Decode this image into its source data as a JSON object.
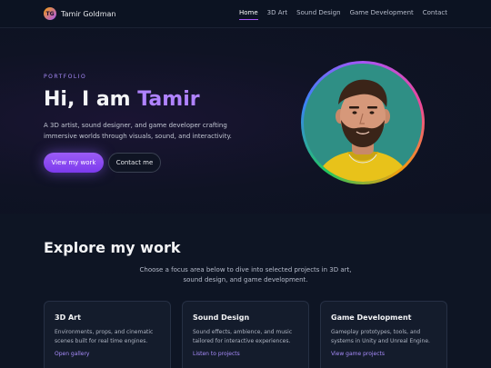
{
  "brand": {
    "initials": "TG",
    "name": "Tamir Goldman"
  },
  "nav": {
    "items": [
      {
        "label": "Home",
        "active": true
      },
      {
        "label": "3D Art",
        "active": false
      },
      {
        "label": "Sound Design",
        "active": false
      },
      {
        "label": "Game Development",
        "active": false
      },
      {
        "label": "Contact",
        "active": false
      }
    ]
  },
  "hero": {
    "kicker": "PORTFOLIO",
    "title_prefix": "Hi, I am ",
    "title_name": "Tamir",
    "description": "A 3D artist, sound designer, and game developer crafting immersive worlds through visuals, sound, and interactivity.",
    "primary_cta": "View my work",
    "secondary_cta": "Contact me"
  },
  "explore": {
    "title": "Explore my work",
    "description": "Choose a focus area below to dive into selected projects in 3D art, sound design, and game development.",
    "cards": [
      {
        "title": "3D Art",
        "text": "Environments, props, and cinematic scenes built for real time engines.",
        "link": "Open gallery"
      },
      {
        "title": "Sound Design",
        "text": "Sound effects, ambience, and music tailored for interactive experiences.",
        "link": "Listen to projects"
      },
      {
        "title": "Game Development",
        "text": "Gameplay prototypes, tools, and systems in Unity and Unreal Engine.",
        "link": "View game projects"
      }
    ]
  },
  "colors": {
    "accent": "#a855f7",
    "background": "#0b1220",
    "avatar_bg": "#2f8f85"
  }
}
